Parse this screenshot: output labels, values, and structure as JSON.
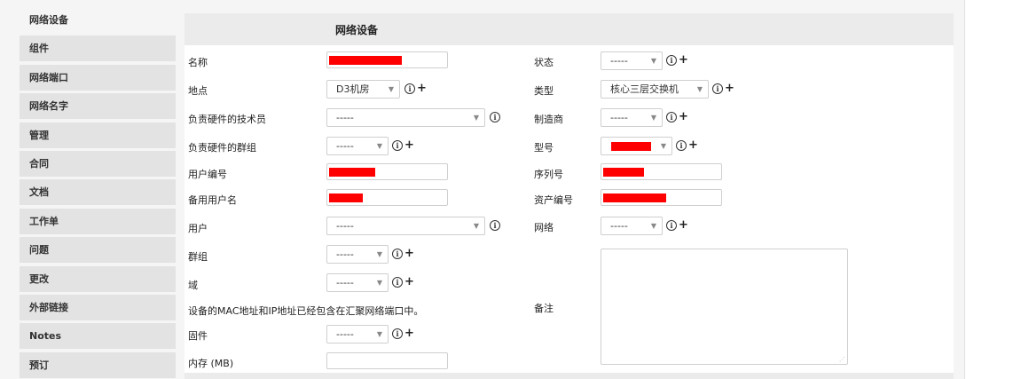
{
  "sidebar": {
    "items": [
      {
        "label": "网络设备",
        "active": true
      },
      {
        "label": "组件"
      },
      {
        "label": "网络端口"
      },
      {
        "label": "网络名字"
      },
      {
        "label": "管理"
      },
      {
        "label": "合同"
      },
      {
        "label": "文档"
      },
      {
        "label": "工作单"
      },
      {
        "label": "问题"
      },
      {
        "label": "更改"
      },
      {
        "label": "外部链接"
      },
      {
        "label": "Notes"
      },
      {
        "label": "预订"
      }
    ]
  },
  "form": {
    "title": "网络设备",
    "left": {
      "name_label": "名称",
      "location_label": "地点",
      "location_value": "D3机房",
      "tech_label": "负责硬件的技术员",
      "tech_value": "-----",
      "tech_group_label": "负责硬件的群组",
      "tech_group_value": "-----",
      "user_number_label": "用户编号",
      "alt_username_label": "备用用户名",
      "user_label": "用户",
      "user_value": "-----",
      "group_label": "群组",
      "group_value": "-----",
      "domain_label": "域",
      "domain_value": "-----",
      "mac_note": "设备的MAC地址和IP地址已经包含在汇聚网络端口中。",
      "firmware_label": "固件",
      "firmware_value": "-----",
      "memory_label": "内存 (MB)"
    },
    "right": {
      "status_label": "状态",
      "status_value": "-----",
      "type_label": "类型",
      "type_value": "核心三层交换机",
      "manufacturer_label": "制造商",
      "manufacturer_value": "-----",
      "model_label": "型号",
      "serial_label": "序列号",
      "asset_label": "资产编号",
      "network_label": "网络",
      "network_value": "-----",
      "comments_label": "备注"
    },
    "icons": {
      "info": "info-icon",
      "add": "plus-icon",
      "dropdown": "chevron-down-icon"
    },
    "colors": {
      "redaction": "#ff0000",
      "header_bg": "#ebebeb",
      "sidebar_bg": "#e3e3e3"
    }
  }
}
